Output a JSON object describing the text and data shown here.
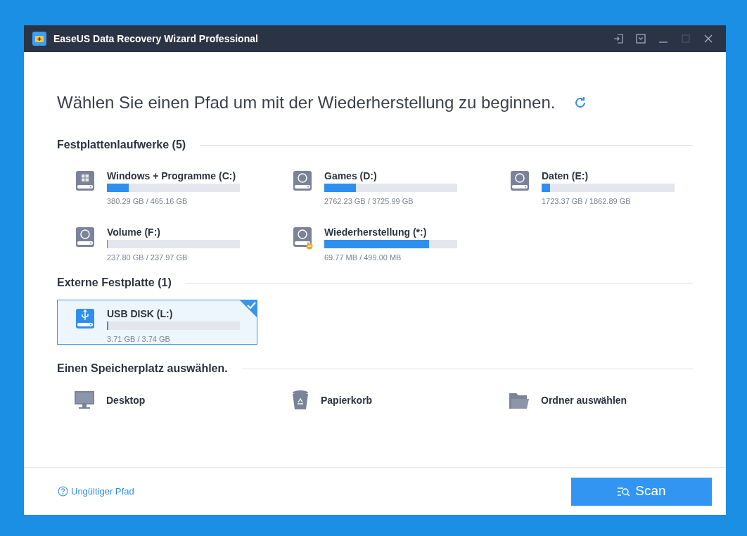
{
  "window": {
    "title": "EaseUS Data Recovery Wizard Professional"
  },
  "heading": "Wählen Sie einen Pfad um mit der Wiederherstellung zu beginnen.",
  "sections": [
    {
      "title": "Festplattenlaufwerke (5)",
      "drives": [
        {
          "kind": "system",
          "name": "Windows + Programme (C:)",
          "level": 0.165,
          "size": "380.29 GB / 465.16 GB",
          "selected": false
        },
        {
          "kind": "disk",
          "name": "Games (D:)",
          "level": 0.24,
          "size": "2762.23 GB / 3725.99 GB",
          "selected": false
        },
        {
          "kind": "disk",
          "name": "Daten (E:)",
          "level": 0.065,
          "size": "1723.37 GB / 1862.89 GB",
          "selected": false
        },
        {
          "kind": "disk",
          "name": "Volume (F:)",
          "level": 0.001,
          "size": "237.80 GB / 237.97 GB",
          "selected": false
        },
        {
          "kind": "recovery",
          "name": "Wiederherstellung (*:)",
          "level": 0.79,
          "size": "69.77 MB / 499.00 MB",
          "selected": false
        }
      ]
    },
    {
      "title": "Externe Festplatte (1)",
      "drives": [
        {
          "kind": "usb",
          "name": "USB DISK (L:)",
          "level": 0.008,
          "size": "3.71 GB / 3.74 GB",
          "selected": true
        }
      ]
    }
  ],
  "locations_title": "Einen Speicherplatz auswählen.",
  "locations": [
    {
      "kind": "desktop",
      "label": "Desktop"
    },
    {
      "kind": "trash",
      "label": "Papierkorb"
    },
    {
      "kind": "folder",
      "label": "Ordner auswählen"
    }
  ],
  "footer": {
    "link": "Ungültiger Pfad",
    "button": "Scan"
  }
}
